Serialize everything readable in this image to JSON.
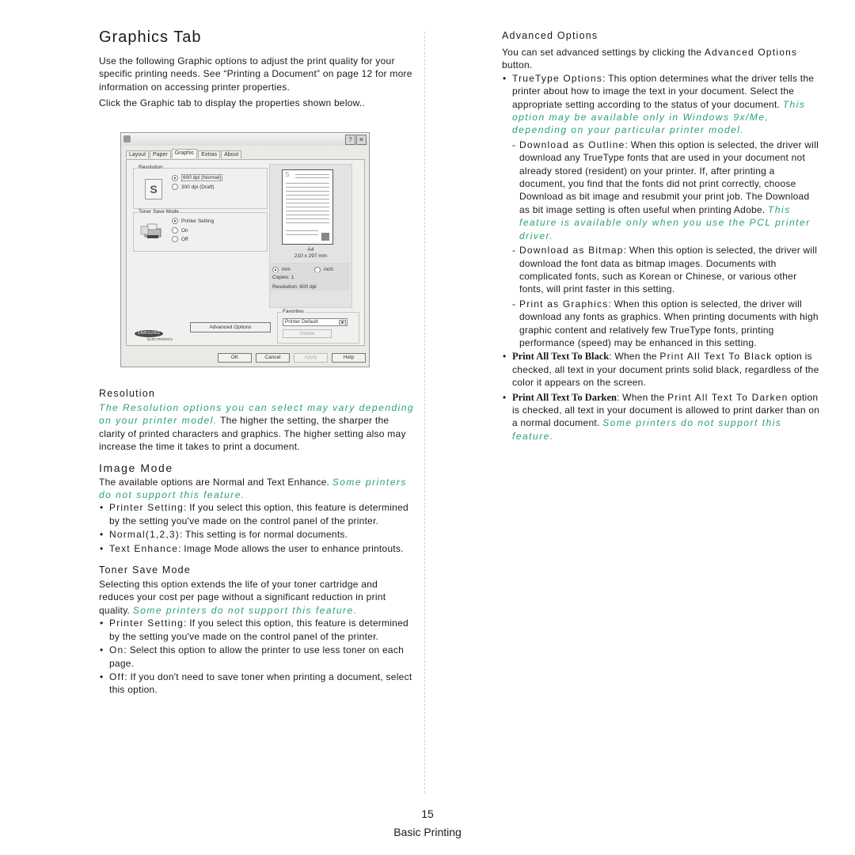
{
  "page": {
    "title": "Graphics Tab",
    "intro": "Use the following Graphic options to adjust the print quality for your specific printing needs. See “Printing a Document” on page 12 for more information on accessing printer properties.",
    "instruction": "Click the Graphic tab to display the properties shown below..",
    "page_number": "15",
    "section_name": "Basic Printing"
  },
  "dialog": {
    "help_button": "?",
    "close_button": "✕",
    "tabs": [
      "Layout",
      "Paper",
      "Graphic",
      "Extras",
      "About"
    ],
    "active_tab": "Graphic",
    "resolution_group": "Resolution",
    "resolution_options": [
      "600 dpi (Normal)",
      "300 dpi (Draft)"
    ],
    "resolution_selected": "600 dpi (Normal)",
    "resolution_icon_letter": "S",
    "toner_group": "Toner Save Mode",
    "toner_options": [
      "Printer Setting",
      "On",
      "Off"
    ],
    "toner_selected": "Printer Setting",
    "preview": {
      "paper_letter": "S",
      "paper_size": "A4",
      "paper_dims": "210 x 297 mm",
      "unit_options": [
        "mm",
        "inch"
      ],
      "unit_selected": "mm",
      "copies": "Copies: 1",
      "resolution": "Resolution: 600 dpi"
    },
    "favorites_group": "Favorites",
    "favorites_value": "Printer Default",
    "delete_button": "Delete",
    "advanced_options_button": "Advanced Options",
    "logo_text": "SAMSUNG",
    "logo_sub": "ELECTRONICS",
    "buttons": {
      "ok": "OK",
      "cancel": "Cancel",
      "apply": "Apply",
      "help": "Help"
    }
  },
  "resolution_section": {
    "heading": "Resolution",
    "note": "The Resolution options you can select may vary depending on your printer model.",
    "body": " The higher the setting, the sharper the clarity of printed characters and graphics. The higher setting also may increase the time it takes to print a document."
  },
  "image_mode_section": {
    "heading": "Image Mode",
    "body": "The available options are Normal and Text Enhance. ",
    "note": "Some printers do not support this feature.",
    "items": [
      {
        "term": "Printer Setting",
        "desc": ": If you select this option, this feature is determined by the setting you've made on the control panel of the printer."
      },
      {
        "term": "Normal(1,2,3)",
        "desc": ": This setting is for normal documents."
      },
      {
        "term": "Text Enhance",
        "desc": ": Image Mode allows the user to enhance printouts."
      }
    ]
  },
  "toner_save_section": {
    "heading": "Toner Save Mode",
    "body": "Selecting this option extends the life of your toner cartridge and reduces your cost per page without a significant reduction in print quality. ",
    "note": "Some printers do not support this feature.",
    "items": [
      {
        "term": "Printer Setting",
        "desc": ": If you select this option, this feature is determined by the setting you've made on the control panel of the printer."
      },
      {
        "term": "On",
        "desc": ": Select this option to allow the printer to use less toner on each page."
      },
      {
        "term": "Off",
        "desc": ": If you don't need to save toner when printing a document, select this option."
      }
    ]
  },
  "advanced_section": {
    "heading": "Advanced Options",
    "intro_a": "You can set advanced settings by clicking the ",
    "intro_term": "Advanced Options",
    "intro_b": " button.",
    "truetype": {
      "term": "TrueType Options",
      "desc": ": This option determines what the driver tells the printer about how to image the text in your document. Select the appropriate setting according to the status of your document. ",
      "note": "This option may be available only in Windows 9x/Me, depending on your particular printer model.",
      "sub_items": [
        {
          "term": "Download as Outline",
          "desc": ": When this option is selected, the driver will download any TrueType fonts that are used in your document not already stored (resident) on your printer. If, after printing a document, you find that the fonts did not print correctly, choose Download as bit image and resubmit your print job. The Download as bit image setting is often useful when printing Adobe. ",
          "note": "This feature is available only when you use the PCL printer driver."
        },
        {
          "term": "Download as Bitmap",
          "desc": ": When this option is selected, the driver will download the font data as bitmap images. Documents with complicated fonts, such as Korean or Chinese, or various other fonts, will print faster in this setting.",
          "note": ""
        },
        {
          "term": "Print as Graphics",
          "desc": ": When this option is selected, the driver will download any fonts as graphics. When printing documents with high graphic content and relatively few TrueType fonts, printing performance (speed) may be enhanced in this setting.",
          "note": ""
        }
      ]
    },
    "black": {
      "term": "Print All Text To Black",
      "desc_a": ": When the ",
      "desc_term": "Print All Text To Black",
      "desc_b": " option is checked, all text in your document prints solid black, regardless of the color it appears on the screen."
    },
    "darken": {
      "term": "Print All Text To Darken",
      "desc_a": ": When the ",
      "desc_term": "Print All Text To Darken",
      "desc_b": " option is checked, all text in your document is allowed to print darker than on a normal document. ",
      "note": "Some printers do not support this feature."
    }
  },
  "colors": {
    "note_green": "#2aa36a",
    "text": "#1a1a1a",
    "divider": "#d0d0d0"
  }
}
